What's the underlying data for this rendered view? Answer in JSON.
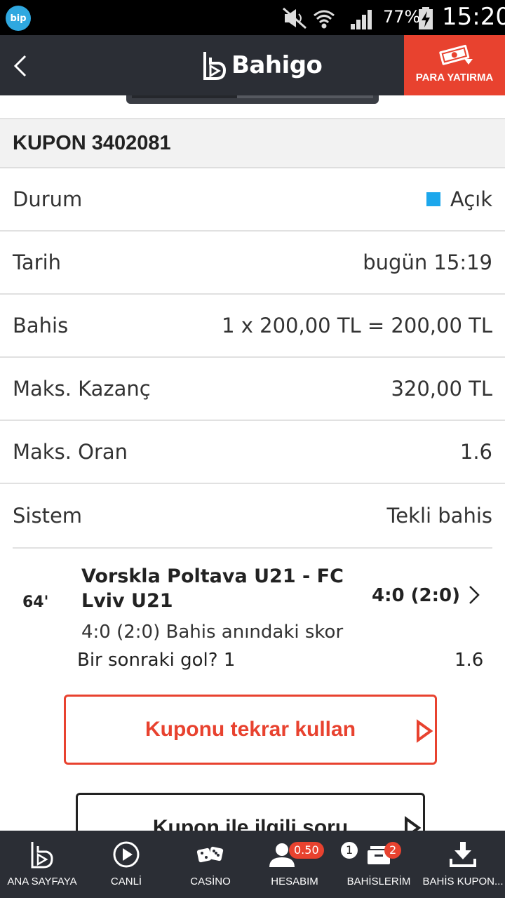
{
  "status_bar": {
    "bip_label": "bip",
    "battery_percent": "77%",
    "time": "15:20"
  },
  "header": {
    "logo_text": "Bahigo",
    "deposit_label": "PARA YATIRMA",
    "accent_color": "#e8422f"
  },
  "coupon": {
    "title": "KUPON 3402081",
    "rows": [
      {
        "label": "Durum",
        "value": "Açık",
        "status_color": "#1ca7ec"
      },
      {
        "label": "Tarih",
        "value": "bugün 15:19"
      },
      {
        "label": "Bahis",
        "value": "1 x 200,00 TL = 200,00 TL"
      },
      {
        "label": "Maks. Kazanç",
        "value": "320,00 TL"
      },
      {
        "label": "Maks. Oran",
        "value": "1.6"
      },
      {
        "label": "Sistem",
        "value": "Tekli bahis"
      }
    ]
  },
  "bet": {
    "minute": "64'",
    "match": "Vorskla Poltava U21 - FC Lviv U21",
    "score": "4:0 (2:0)",
    "note": "4:0 (2:0) Bahis anındaki skor",
    "market": "Bir sonraki gol? 1",
    "odds": "1.6"
  },
  "actions": {
    "reuse_label": "Kuponu tekrar kullan",
    "question_label": "Kupon ile ilgili soru"
  },
  "bottom_nav": {
    "items": [
      {
        "label": "ANA SAYFAYA",
        "icon": "home-logo-icon"
      },
      {
        "label": "CANLİ",
        "icon": "play-icon"
      },
      {
        "label": "CASİNO",
        "icon": "dice-icon"
      },
      {
        "label": "HESABIM",
        "icon": "user-icon",
        "badge": "0.50"
      },
      {
        "label": "BAHİSLERİM",
        "icon": "bets-icon",
        "badge_left": "1",
        "badge_right": "2"
      },
      {
        "label": "BAHİS KUPON...",
        "icon": "download-icon"
      }
    ]
  }
}
